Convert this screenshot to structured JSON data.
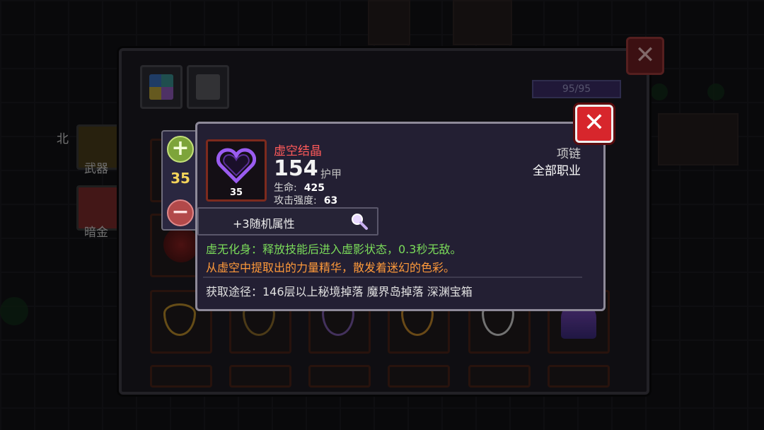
{
  "background": {
    "side_labels": [
      "北",
      "武器",
      "暗金"
    ]
  },
  "main_panel": {
    "hp_text": "95/95",
    "close_icon": "close-icon"
  },
  "quantity": {
    "plus": "+",
    "value": "35",
    "minus": "−"
  },
  "item": {
    "name": "虚空结晶",
    "level": "35",
    "armor_value": "154",
    "armor_label": "护甲",
    "stats": [
      {
        "label": "生命:",
        "value": "425"
      },
      {
        "label": "攻击强度:",
        "value": "63"
      }
    ],
    "slot_type": "项链",
    "class_requirement": "全部职业",
    "random_attributes": "+3随机属性",
    "set_effect": "虚无化身：释放技能后进入虚影状态，0.3秒无敌。",
    "flavor_text": "从虚空中提取出的力量精华，散发着迷幻的色彩。",
    "source": "获取途径：146层以上秘境掉落 魔界岛掉落 深渊宝箱"
  },
  "colors": {
    "item_name": "#ff5a5a",
    "set_effect": "#7bdc5a",
    "flavor": "#ff9a3a",
    "quantity": "#f3d35a"
  }
}
